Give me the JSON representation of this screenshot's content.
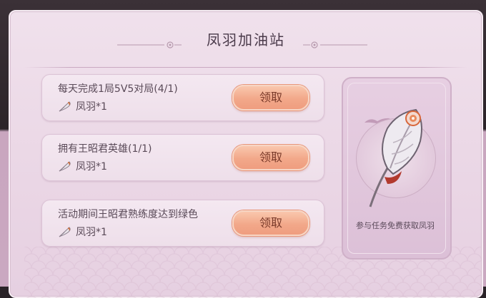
{
  "panel": {
    "title": "凤羽加油站"
  },
  "tasks": [
    {
      "title": "每天完成1局5V5对局(4/1)",
      "reward": "凤羽*1",
      "button": "领取"
    },
    {
      "title": "拥有王昭君英雄(1/1)",
      "reward": "凤羽*1",
      "button": "领取"
    },
    {
      "title": "活动期间王昭君熟练度达到绿色",
      "reward": "凤羽*1",
      "button": "领取"
    }
  ],
  "side": {
    "caption": "参与任务免费获取凤羽"
  },
  "icons": {
    "reward": "feather-icon",
    "decor": "cloud-ornament-icon",
    "bird": "bird-icon"
  },
  "colors": {
    "panel": "#ead6e5",
    "button": "#f2a88a",
    "text": "#5a4a58"
  }
}
